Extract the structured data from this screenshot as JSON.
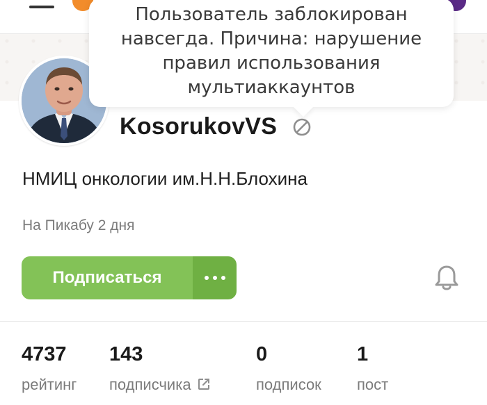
{
  "tooltip": {
    "lines": [
      "Пользователь заблокирован",
      "навсегда. Причина: нарушение",
      "правил использования",
      "мультиаккаунтов"
    ]
  },
  "profile": {
    "username": "KosorukovVS",
    "subtitle": "НМИЦ онкологии им.Н.Н.Блохина",
    "since": "На Пикабу 2 дня"
  },
  "actions": {
    "subscribe_label": "Подписаться"
  },
  "stats": [
    {
      "value": "4737",
      "label": "рейтинг"
    },
    {
      "value": "143",
      "label": "подписчика"
    },
    {
      "value": "0",
      "label": "подписок"
    },
    {
      "value": "1",
      "label": "пост"
    }
  ],
  "icons": {
    "menu": "hamburger-icon",
    "banned": "ban-icon",
    "more": "more-dots-icon",
    "notifications": "bell-icon",
    "external": "external-link-icon"
  },
  "colors": {
    "accent_green": "#83c257",
    "accent_green_dark": "#6fb043",
    "muted_text": "#7b7b7b"
  }
}
